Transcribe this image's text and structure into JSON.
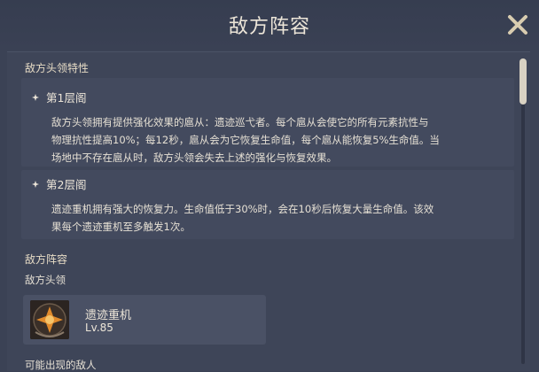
{
  "header": {
    "title": "敌方阵容",
    "close_icon": "close-icon"
  },
  "traits": {
    "heading": "敌方头领特性",
    "layers": [
      {
        "label": "第1层阁",
        "lines": [
          "敌方头领拥有提供强化效果的扈从：遗迹巡弋者。每个扈从会使它的所有元素抗性与",
          "物理抗性提高10%；每12秒，扈从会为它恢复生命值，每个扈从能恢复5%生命值。当",
          "场地中不存在扈从时，敌方头领会失去上述的强化与恢复效果。"
        ]
      },
      {
        "label": "第2层阁",
        "lines": [
          "遗迹重机拥有强大的恢复力。生命值低于30%时，会在10秒后恢复大量生命值。该效",
          "果每个遗迹重机至多触发1次。"
        ]
      }
    ]
  },
  "lineup": {
    "heading": "敌方阵容",
    "boss_label": "敌方头领",
    "boss": {
      "name": "遗迹重机",
      "level": "Lv.85"
    },
    "possible_enemies_label": "可能出现的敌人"
  },
  "colors": {
    "background": "#3b4255",
    "text": "#ece5d8",
    "card": "#434a5e"
  }
}
